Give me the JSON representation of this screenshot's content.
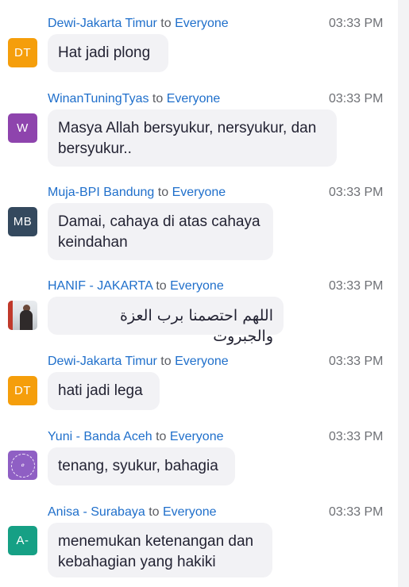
{
  "chat": {
    "to_word": "to",
    "messages": [
      {
        "sender": "Dewi-Jakarta Timur",
        "recipient": "Everyone",
        "time": "03:33 PM",
        "avatar_initials": "DT",
        "avatar_color": "#f59e0b",
        "text": "Hat jadi plong"
      },
      {
        "sender": "WinanTuningTyas",
        "recipient": "Everyone",
        "time": "03:33 PM",
        "avatar_initials": "W",
        "avatar_color": "#8e44ad",
        "text": "Masya Allah bersyukur, nersyukur, dan bersyukur.."
      },
      {
        "sender": "Muja-BPI Bandung",
        "recipient": "Everyone",
        "time": "03:33 PM",
        "avatar_initials": "MB",
        "avatar_color": "#34495e",
        "text": "Damai, cahaya di atas cahaya keindahan"
      },
      {
        "sender": "HANIF - JAKARTA",
        "recipient": "Everyone",
        "time": "03:33 PM",
        "avatar_icon": "profile-photo",
        "text": "اللهم احتصمنا برب العزة والجبروت"
      },
      {
        "sender": "Dewi-Jakarta Timur",
        "recipient": "Everyone",
        "time": "03:33 PM",
        "avatar_initials": "DT",
        "avatar_color": "#f59e0b",
        "text": "hati jadi lega"
      },
      {
        "sender": "Yuni - Banda Aceh",
        "recipient": "Everyone",
        "time": "03:33 PM",
        "avatar_icon": "purple-logo-badge",
        "avatar_color": "#8f5fc4",
        "text": "tenang, syukur, bahagia"
      },
      {
        "sender": "Anisa - Surabaya",
        "recipient": "Everyone",
        "time": "03:33 PM",
        "avatar_initials": "A-",
        "avatar_color": "#16a085",
        "text": "menemukan ketenangan dan kebahagian yang hakiki"
      }
    ]
  }
}
